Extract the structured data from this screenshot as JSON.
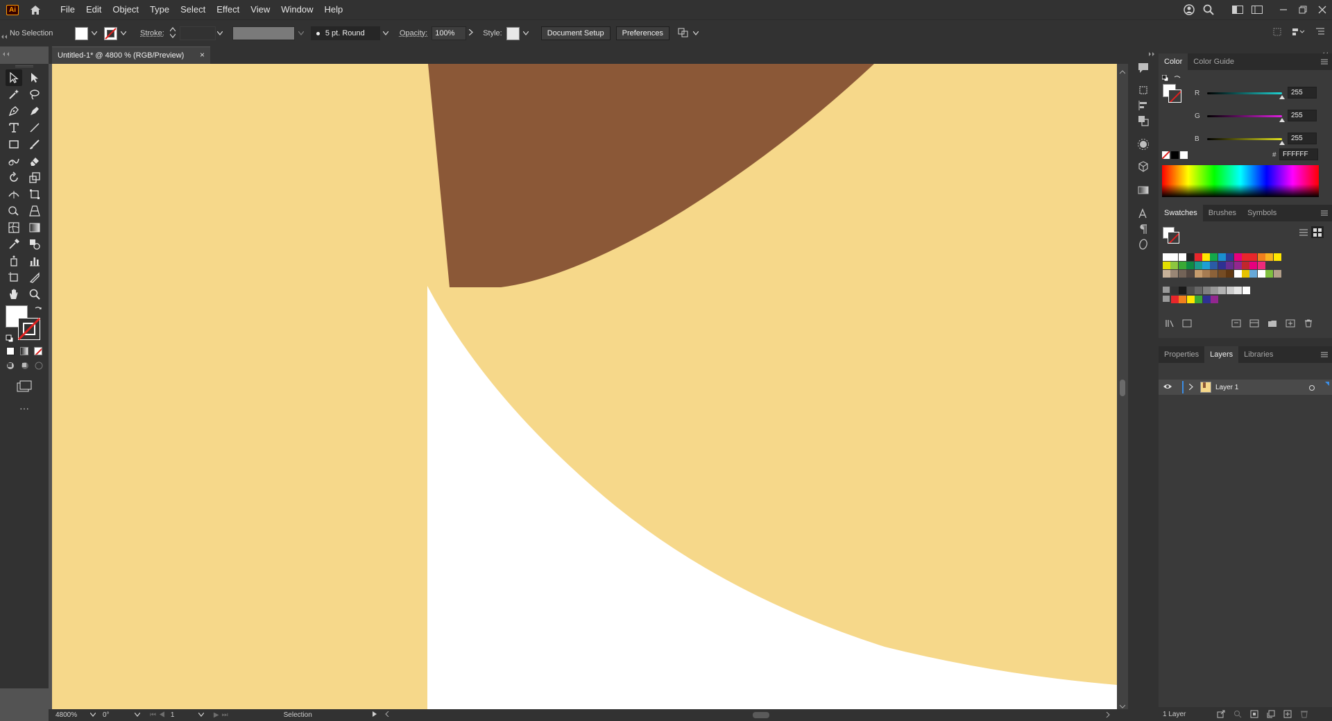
{
  "app": {
    "logo_text": "Ai",
    "menus": [
      "File",
      "Edit",
      "Object",
      "Type",
      "Select",
      "Effect",
      "View",
      "Window",
      "Help"
    ]
  },
  "control_bar": {
    "selection_label": "No Selection",
    "stroke_label": "Stroke:",
    "brush_value": "5 pt. Round",
    "opacity_label": "Opacity:",
    "opacity_value": "100%",
    "style_label": "Style:",
    "document_setup_label": "Document Setup",
    "preferences_label": "Preferences"
  },
  "document": {
    "tab_title": "Untitled-1* @ 4800 % (RGB/Preview)",
    "close_glyph": "×"
  },
  "artwork": {
    "colors": {
      "tan": "#f6d88a",
      "brown": "#8b5837",
      "white": "#ffffff",
      "pasteboard": "#535353"
    }
  },
  "status_bar": {
    "zoom": "4800%",
    "rotation": "0°",
    "artboard": "1",
    "tool": "Selection"
  },
  "color_panel": {
    "tabs": [
      "Color",
      "Color Guide"
    ],
    "active_tab": "Color",
    "r_label": "R",
    "g_label": "G",
    "b_label": "B",
    "r_value": "255",
    "g_value": "255",
    "b_value": "255",
    "hex_prefix": "#",
    "hex_value": "FFFFFF",
    "colors": {
      "r": "#1fd3d3",
      "g": "#e01fe0",
      "b": "#e0e01f"
    }
  },
  "swatches_panel": {
    "tabs": [
      "Swatches",
      "Brushes",
      "Symbols"
    ],
    "active_tab": "Swatches",
    "row1": [
      "#ffffff",
      "#ffffff",
      "#ffffff",
      "#222222",
      "#e8262b",
      "#ffe600",
      "#13a94a",
      "#1a8fd1",
      "#2c3b94",
      "#e6007e",
      "#e8262b",
      "#e8262b",
      "#f07f1e",
      "#f7b21f",
      "#ffe600"
    ],
    "row2": [
      "#e2e000",
      "#8cc63f",
      "#3aa935",
      "#0f8b43",
      "#199c8b",
      "#1d9fd4",
      "#2a5ba6",
      "#2e3192",
      "#662d91",
      "#92278f",
      "#c1272d",
      "#e6007e",
      "#ee2a7b"
    ],
    "row3": [
      "#c7b299",
      "#998675",
      "#736357",
      "#534741",
      "#c69c6d",
      "#a67c52",
      "#8c6239",
      "#754c24",
      "#603813",
      "#ffffff",
      "#e6c200",
      "#67a9d9",
      "#ffffff",
      "#7fbf3f",
      "#b39f89"
    ],
    "row4": [
      "#333333",
      "#1a1a1a",
      "#4d4d4d",
      "#666666",
      "#808080",
      "#999999",
      "#b3b3b3",
      "#cccccc",
      "#e6e6e6",
      "#ffffff"
    ],
    "row5": [
      "#e8262b",
      "#f07f1e",
      "#ffe600",
      "#3aa935",
      "#2e3192",
      "#92278f"
    ]
  },
  "layers_panel": {
    "tabs": [
      "Properties",
      "Layers",
      "Libraries"
    ],
    "active_tab": "Layers",
    "layer_name": "Layer 1",
    "layer_count": "1 Layer"
  }
}
